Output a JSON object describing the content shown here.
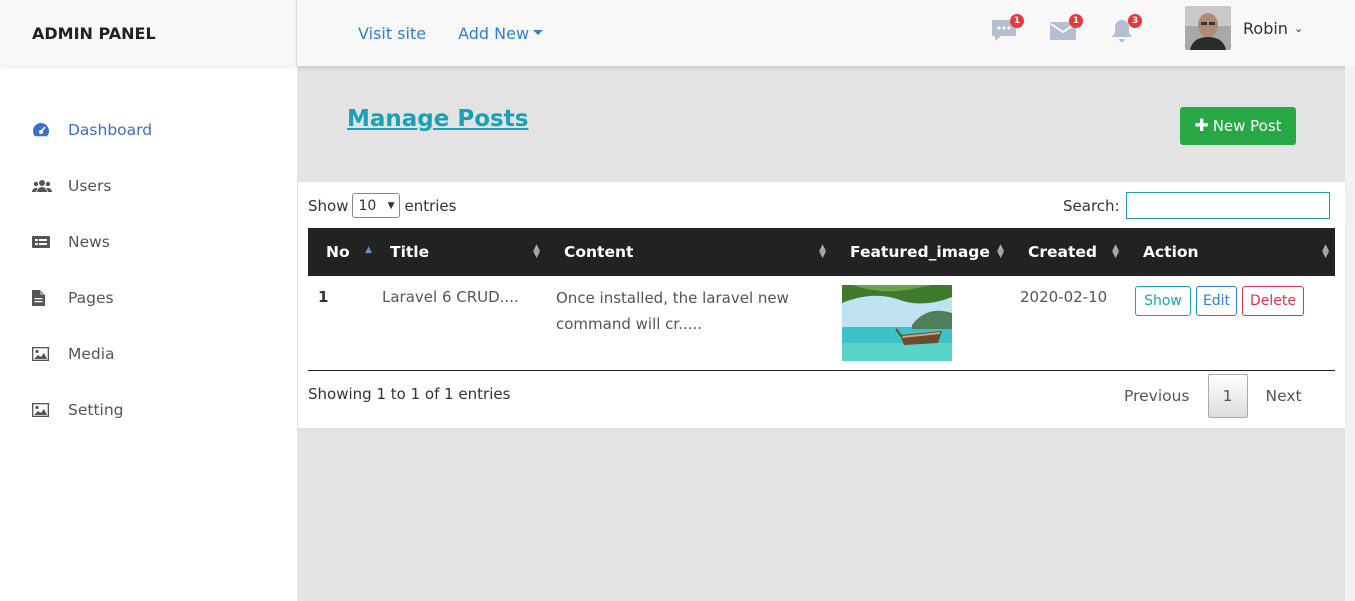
{
  "brand": "ADMIN PANEL",
  "topbar": {
    "visit_site": "Visit site",
    "add_new": "Add New",
    "notifications": [
      {
        "icon": "chat-icon",
        "count": "1"
      },
      {
        "icon": "mail-icon",
        "count": "1"
      },
      {
        "icon": "bell-icon",
        "count": "3"
      }
    ],
    "user_name": "Robin"
  },
  "sidebar": {
    "items": [
      {
        "label": "Dashboard",
        "icon": "dashboard-icon",
        "active": true
      },
      {
        "label": "Users",
        "icon": "users-icon"
      },
      {
        "label": "News",
        "icon": "news-icon"
      },
      {
        "label": "Pages",
        "icon": "page-icon"
      },
      {
        "label": "Media",
        "icon": "image-icon"
      },
      {
        "label": "Setting",
        "icon": "image-icon"
      }
    ]
  },
  "page": {
    "title": "Manage Posts",
    "new_post_label": "New Post"
  },
  "table_controls": {
    "show_label": "Show",
    "entries_value": "10",
    "entries_label": "entries",
    "search_label": "Search:",
    "search_value": ""
  },
  "table": {
    "columns": [
      "No",
      "Title",
      "Content",
      "Featured_image",
      "Created",
      "Action"
    ],
    "rows": [
      {
        "no": "1",
        "title": "Laravel 6 CRUD....",
        "content": "Once installed, the laravel new command will cr.....",
        "created": "2020-02-10",
        "actions": {
          "show": "Show",
          "edit": "Edit",
          "delete": "Delete"
        }
      }
    ]
  },
  "footer": {
    "info": "Showing 1 to 1 of 1 entries",
    "previous": "Previous",
    "page": "1",
    "next": "Next"
  },
  "colors": {
    "accent": "#17a2b8",
    "link": "#2f7fd6",
    "success": "#28a745",
    "danger": "#dc3545",
    "badge": "#e5393a",
    "table_header": "#222222"
  }
}
